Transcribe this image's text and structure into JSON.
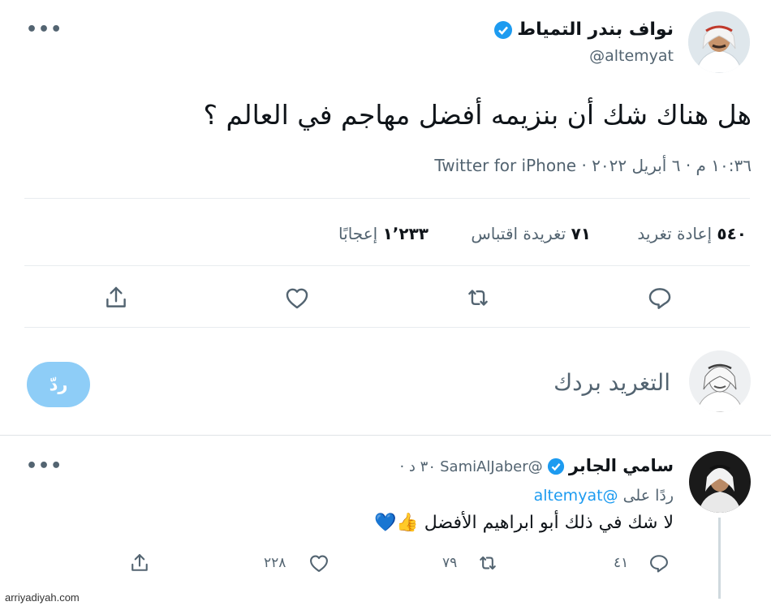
{
  "tweet": {
    "display_name": "نواف بندر التمياط",
    "handle": "@altemyat",
    "text": "هل هناك شك أن بنزيمه أفضل مهاجم في العالم ؟",
    "timestamp": "١٠:٣٦ م · ٦ أبريل ٢٠٢٢ ·",
    "source": "Twitter for iPhone",
    "stats": {
      "retweets_count": "٥٤٠",
      "retweets_label": "إعادة تغريد",
      "quotes_count": "٧١",
      "quotes_label": "تغريدة اقتباس",
      "likes_count": "١٬٢٣٣",
      "likes_label": "إعجابًا"
    }
  },
  "compose": {
    "placeholder": "التغريد بردك",
    "reply_label": "ردّ"
  },
  "reply": {
    "display_name": "سامي الجابر",
    "handle": "@SamiAlJaber",
    "time": "٣٠ د ·",
    "replying_prefix": "ردًا على",
    "replying_to": "@altemyat",
    "text": "لا شك في ذلك أبو ابراهيم الأفضل",
    "emoji": "👍💙",
    "counts": {
      "replies": "٤١",
      "retweets": "٧٩",
      "likes": "٢٢٨"
    }
  },
  "more_label": "•••",
  "watermark": "arriyadiyah.com",
  "colors": {
    "accent": "#1d9bf0",
    "text": "#0f1419",
    "muted": "#536471",
    "reply_button": "#8ecdf7"
  }
}
